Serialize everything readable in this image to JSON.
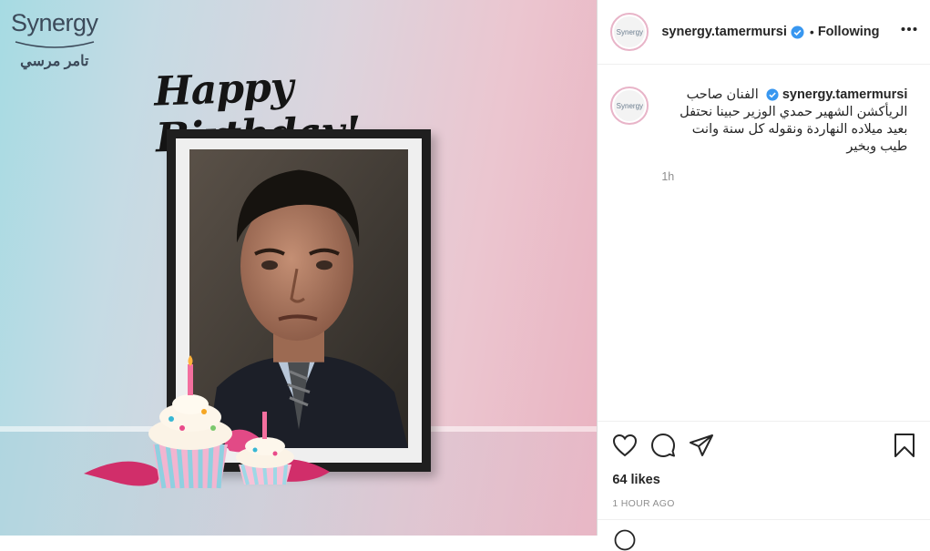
{
  "media": {
    "brand_latin": "Synergy",
    "brand_arabic": "تامر مرسي",
    "headline": "Happy Birthday!"
  },
  "header": {
    "username": "synergy.tamermursi",
    "separator": "•",
    "follow_status": "Following",
    "avatar_text": "Synergy"
  },
  "caption": {
    "username": "synergy.tamermursi",
    "text": "الفنان صاحب الريأكشن الشهير حمدي الوزير حبينا نحتفل بعيد ميلاده النهاردة ونقوله كل سنة وانت طيب وبخير",
    "time": "1h"
  },
  "actions": {
    "likes": "64 likes",
    "posted_ago": "1 HOUR AGO"
  },
  "icons": [
    "heart-icon",
    "comment-icon",
    "share-icon",
    "bookmark-icon",
    "more-icon",
    "verified-icon",
    "emoji-icon"
  ],
  "colors": {
    "verified": "#3897f0",
    "text": "#262626",
    "muted": "#8e8e8e",
    "border": "#dbdbdb"
  }
}
